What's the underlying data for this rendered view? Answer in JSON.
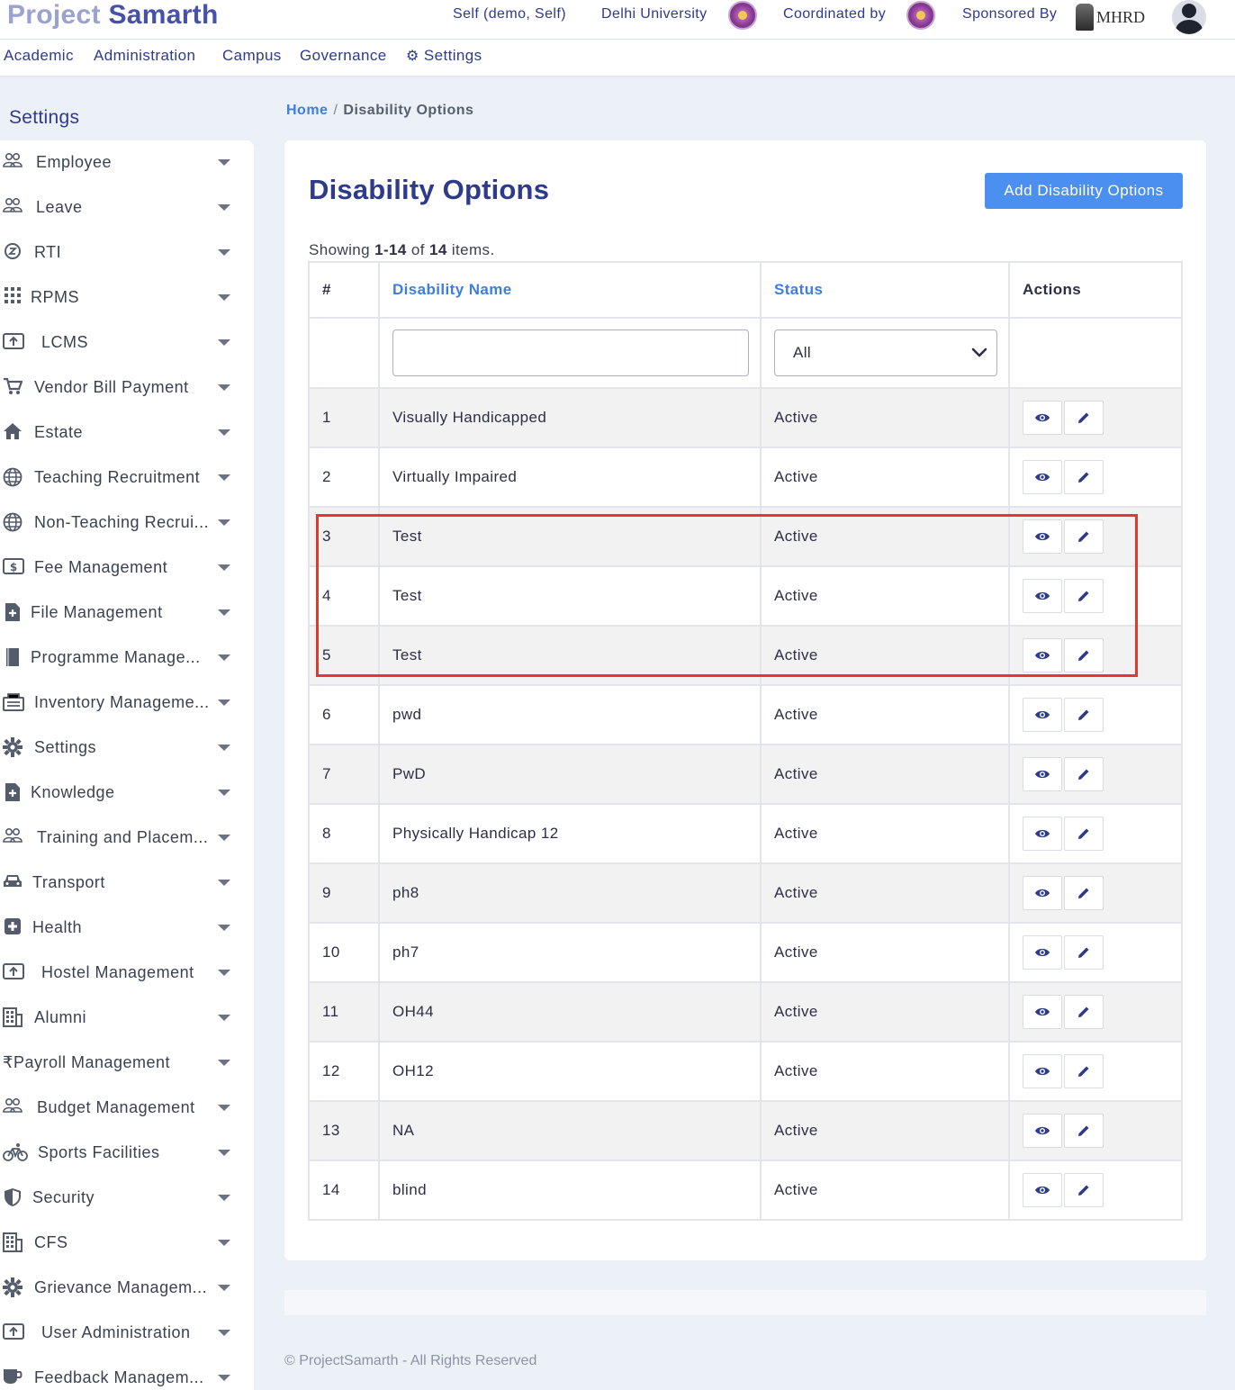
{
  "header": {
    "logo_part1": "Project",
    "logo_part2": "Samarth",
    "user": "Self (demo, Self)",
    "university": "Delhi University",
    "coordinated": "Coordinated by",
    "sponsored": "Sponsored By",
    "sponsor_name": "MHRD"
  },
  "menu": {
    "academic": "Academic",
    "administration": "Administration",
    "campus": "Campus",
    "governance": "Governance",
    "settings": "Settings"
  },
  "sidebar": {
    "title": "Settings",
    "items": [
      {
        "label": "Employee",
        "icon": "users-icon"
      },
      {
        "label": "Leave",
        "icon": "users-icon"
      },
      {
        "label": "RTI",
        "icon": "clock-icon"
      },
      {
        "label": "RPMS",
        "icon": "grid-icon"
      },
      {
        "label": "LCMS",
        "icon": "upload-box-icon"
      },
      {
        "label": "Vendor Bill Payment",
        "icon": "cart-icon"
      },
      {
        "label": "Estate",
        "icon": "home-icon"
      },
      {
        "label": "Teaching Recruitment",
        "icon": "globe-icon"
      },
      {
        "label": "Non-Teaching Recrui...",
        "icon": "globe-icon"
      },
      {
        "label": "Fee Management",
        "icon": "money-icon"
      },
      {
        "label": "File Management",
        "icon": "file-plus-icon"
      },
      {
        "label": "Programme Manage...",
        "icon": "book-icon"
      },
      {
        "label": "Inventory Manageme...",
        "icon": "inventory-icon"
      },
      {
        "label": "Settings",
        "icon": "gear-icon"
      },
      {
        "label": "Knowledge",
        "icon": "file-plus-icon"
      },
      {
        "label": "Training and Placem...",
        "icon": "users-icon"
      },
      {
        "label": "Transport",
        "icon": "car-icon"
      },
      {
        "label": "Health",
        "icon": "health-icon"
      },
      {
        "label": "Hostel Management",
        "icon": "upload-box-icon"
      },
      {
        "label": "Alumni",
        "icon": "building-icon"
      },
      {
        "label": "₹Payroll Management",
        "icon": ""
      },
      {
        "label": "Budget Management",
        "icon": "users-icon"
      },
      {
        "label": "Sports Facilities",
        "icon": "bicycle-icon"
      },
      {
        "label": "Security",
        "icon": "shield-icon"
      },
      {
        "label": "CFS",
        "icon": "building-icon"
      },
      {
        "label": "Grievance Managem...",
        "icon": "gear-icon"
      },
      {
        "label": "User Administration",
        "icon": "upload-box-icon"
      },
      {
        "label": "Feedback Managem...",
        "icon": "cup-icon"
      }
    ]
  },
  "breadcrumb": {
    "home": "Home",
    "separator": "/",
    "current": "Disability Options"
  },
  "page": {
    "title": "Disability Options",
    "add_button": "Add Disability Options",
    "summary_prefix": "Showing ",
    "summary_range": "1-14",
    "summary_of": " of ",
    "summary_total": "14",
    "summary_suffix": " items."
  },
  "table": {
    "headers": {
      "num": "#",
      "name": "Disability Name",
      "status": "Status",
      "actions": "Actions"
    },
    "filter": {
      "name_value": "",
      "status_selected": "All"
    },
    "rows": [
      {
        "num": "1",
        "name": "Visually Handicapped",
        "status": "Active"
      },
      {
        "num": "2",
        "name": "Virtually Impaired",
        "status": "Active"
      },
      {
        "num": "3",
        "name": "Test",
        "status": "Active"
      },
      {
        "num": "4",
        "name": "Test",
        "status": "Active"
      },
      {
        "num": "5",
        "name": "Test",
        "status": "Active"
      },
      {
        "num": "6",
        "name": "pwd",
        "status": "Active"
      },
      {
        "num": "7",
        "name": "PwD",
        "status": "Active"
      },
      {
        "num": "8",
        "name": "Physically Handicap 12",
        "status": "Active"
      },
      {
        "num": "9",
        "name": "ph8",
        "status": "Active"
      },
      {
        "num": "10",
        "name": "ph7",
        "status": "Active"
      },
      {
        "num": "11",
        "name": "OH44",
        "status": "Active"
      },
      {
        "num": "12",
        "name": "OH12",
        "status": "Active"
      },
      {
        "num": "13",
        "name": "NA",
        "status": "Active"
      },
      {
        "num": "14",
        "name": "blind",
        "status": "Active"
      }
    ]
  },
  "footer": {
    "copyright": "© ProjectSamarth - All Rights Reserved"
  },
  "colors": {
    "primary": "#2e3a8c",
    "link": "#3d7ee0",
    "button": "#4b8ff0",
    "highlight": "#e2392a",
    "background": "#ecf0f7"
  }
}
